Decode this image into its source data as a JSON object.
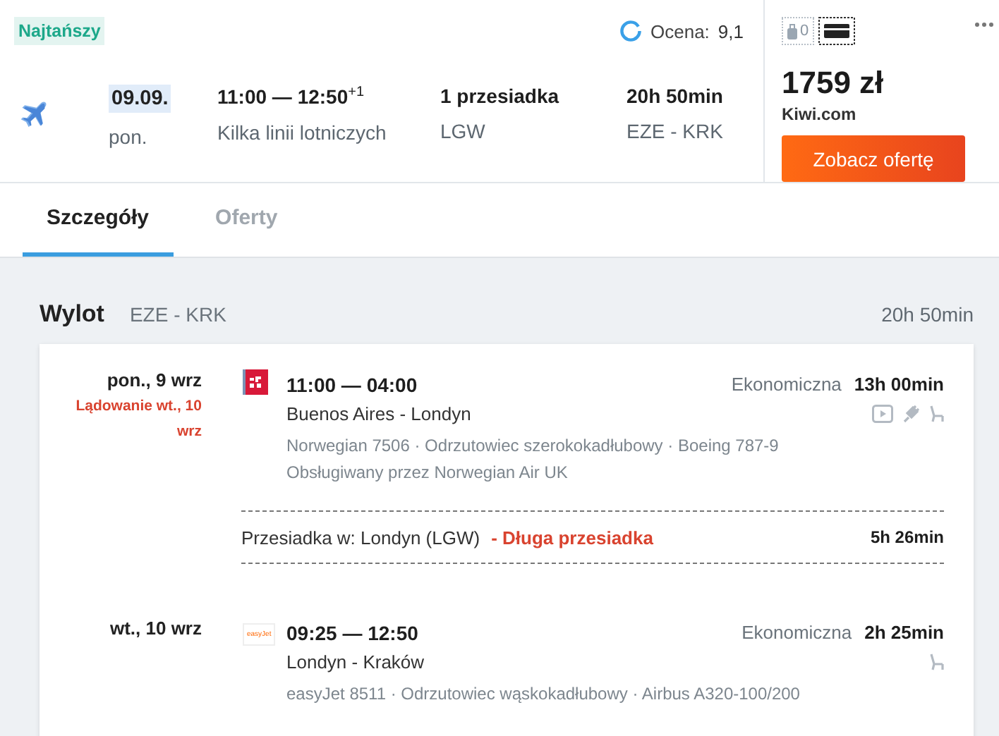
{
  "badge": "Najtańszy",
  "rating": {
    "label": "Ocena:",
    "value": "9,1"
  },
  "summary": {
    "date": "09.09.",
    "weekday": "pon.",
    "times": "11:00 — 12:50",
    "day_offset": "+1",
    "airlines": "Kilka linii lotniczych",
    "stops": "1 przesiadka",
    "stop_airport": "LGW",
    "duration": "20h 50min",
    "route": "EZE - KRK"
  },
  "offer": {
    "bag_count": "0",
    "price": "1759 zł",
    "provider": "Kiwi.com",
    "button": "Zobacz ofertę"
  },
  "tabs": [
    {
      "label": "Szczegóły",
      "selected": true
    },
    {
      "label": "Oferty",
      "selected": false
    }
  ],
  "section": {
    "title": "Wylot",
    "route": "EZE - KRK",
    "duration": "20h 50min"
  },
  "items": [
    {
      "kind": "segment",
      "date": "pon., 9 wrz",
      "landing": "Lądowanie wt., 10 wrz",
      "logo": {
        "kind": "mark"
      },
      "times": "11:00 — 04:00",
      "route": "Buenos Aires - Londyn",
      "details": "Norwegian 7506 · Odrzutowiec szerokokadłubowy · Boeing 787-9",
      "operated": "Obsługiwany przez Norwegian Air UK",
      "cabin": "Ekonomiczna",
      "duration": "13h 00min",
      "amenities": [
        {
          "kind": "video"
        },
        {
          "kind": "power"
        },
        {
          "kind": "seat"
        }
      ]
    },
    {
      "kind": "layover",
      "text": "Przesiadka w: Londyn (LGW)",
      "warning": "- Długa przesiadka",
      "duration": "5h 26min"
    },
    {
      "kind": "segment",
      "date": "wt., 10 wrz",
      "logo": {
        "kind": "text",
        "text": "easyJet"
      },
      "times": "09:25 — 12:50",
      "route": "Londyn - Kraków",
      "details": "easyJet 8511 · Odrzutowiec wąskokadłubowy · Airbus A320-100/200",
      "cabin": "Ekonomiczna",
      "duration": "2h 25min",
      "amenities": [
        {
          "kind": "seat"
        }
      ]
    }
  ]
}
